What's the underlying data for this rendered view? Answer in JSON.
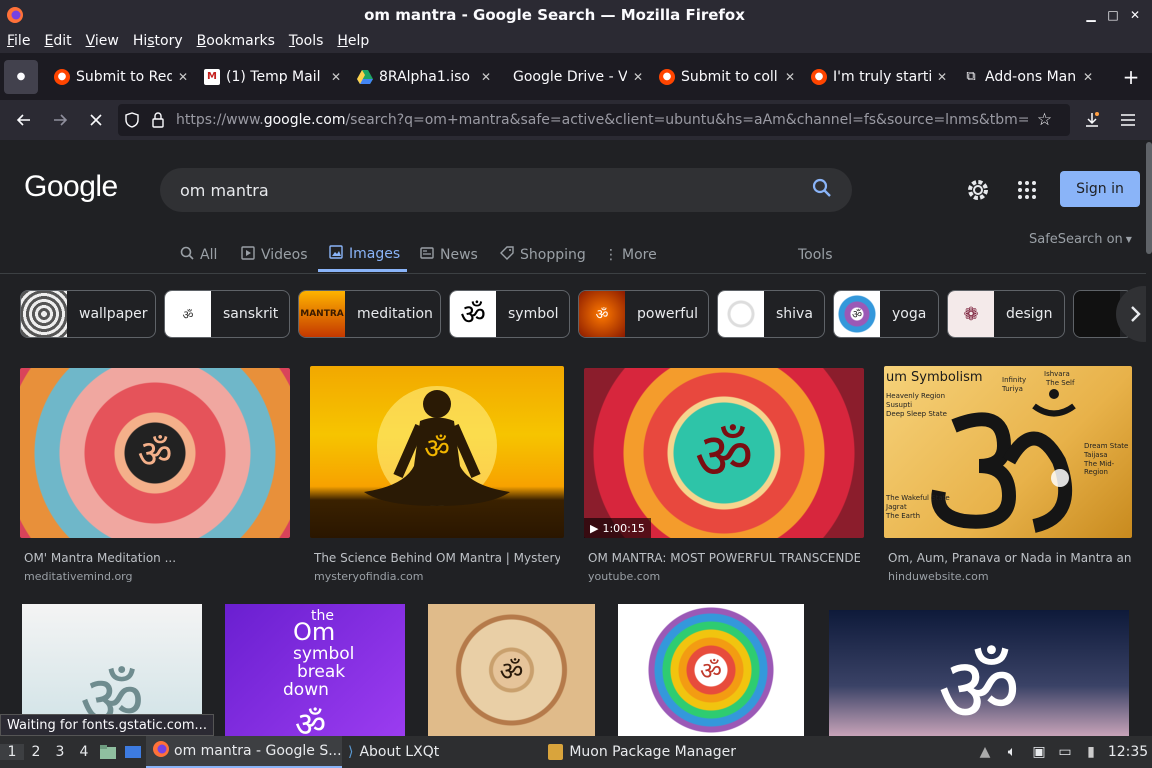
{
  "window": {
    "title": "om mantra - Google Search — Mozilla Firefox"
  },
  "menu": [
    {
      "pre": "",
      "u": "F",
      "post": "ile"
    },
    {
      "pre": "",
      "u": "E",
      "post": "dit"
    },
    {
      "pre": "",
      "u": "V",
      "post": "iew"
    },
    {
      "pre": "Hi",
      "u": "s",
      "post": "tory"
    },
    {
      "pre": "",
      "u": "B",
      "post": "ookmarks"
    },
    {
      "pre": "",
      "u": "T",
      "post": "ools"
    },
    {
      "pre": "",
      "u": "H",
      "post": "elp"
    }
  ],
  "tabs": [
    {
      "label": "Submit to Red",
      "icon": "reddit-icon",
      "color": "#ff4500"
    },
    {
      "label": "(1) Temp Mail",
      "icon": "mail-icon",
      "color": "#c5221f"
    },
    {
      "label": "8RAlpha1.iso",
      "icon": "google-drive-icon",
      "color": "#1fa463"
    },
    {
      "label": "Google Drive - Vi",
      "icon": "none",
      "color": ""
    },
    {
      "label": "Submit to coll",
      "icon": "reddit-icon",
      "color": "#ff4500"
    },
    {
      "label": "I'm truly starti",
      "icon": "reddit-icon",
      "color": "#ff4500"
    },
    {
      "label": "Add-ons Mana",
      "icon": "puzzle-icon",
      "color": "#fbfbfe"
    }
  ],
  "url": {
    "prefix": "https://www.",
    "domain": "google.com",
    "rest": "/search?q=om+mantra&safe=active&client=ubuntu&hs=aAm&channel=fs&source=lnms&tbm="
  },
  "google": {
    "logo": "Google",
    "query": "om mantra",
    "signin": "Sign in",
    "tabs": [
      {
        "label": "All",
        "icon": "search-icon"
      },
      {
        "label": "Videos",
        "icon": "video-icon"
      },
      {
        "label": "Images",
        "icon": "image-icon"
      },
      {
        "label": "News",
        "icon": "news-icon"
      },
      {
        "label": "Shopping",
        "icon": "tag-icon"
      },
      {
        "label": "More",
        "icon": "kebab-icon"
      }
    ],
    "tools": "Tools",
    "safesearch": "SafeSearch on",
    "chips": [
      "wallpaper",
      "sanskrit",
      "meditation",
      "symbol",
      "powerful",
      "shiva",
      "yoga",
      "design"
    ],
    "chip_thumb_text": {
      "meditation": "MANTRA"
    },
    "results": [
      {
        "title": "OM' Mantra Meditation ...",
        "site": "meditativemind.org"
      },
      {
        "title": "The Science Behind OM Mantra | Mystery ...",
        "site": "mysteryofindia.com"
      },
      {
        "title": "OM MANTRA: MOST POWERFUL TRANSCENDE...",
        "site": "youtube.com",
        "duration": "1:00:15"
      },
      {
        "title": "Om, Aum, Pranava or Nada in Mantra and ...",
        "site": "hinduwebsite.com"
      }
    ],
    "img4_texts": {
      "heading": "um Symbolism",
      "labels": [
        "Infinity",
        "Turiya",
        "Ishvara",
        "The Self",
        "Heavenly Region",
        "Susupti",
        "Deep Sleep State",
        "Dream State",
        "Taijasa",
        "The Mid-Region",
        "The Wakeful State",
        "Jagrat",
        "The Earth"
      ]
    },
    "row2_texts": {
      "img2": [
        "the",
        "Om",
        "symbol",
        "break",
        "down"
      ]
    }
  },
  "status": "Waiting for fonts.gstatic.com...",
  "taskbar": {
    "workspaces": [
      "1",
      "2",
      "3",
      "4"
    ],
    "tasks": [
      "om mantra - Google S...",
      "About LXQt",
      "Muon Package Manager"
    ],
    "clock": "12:35"
  }
}
